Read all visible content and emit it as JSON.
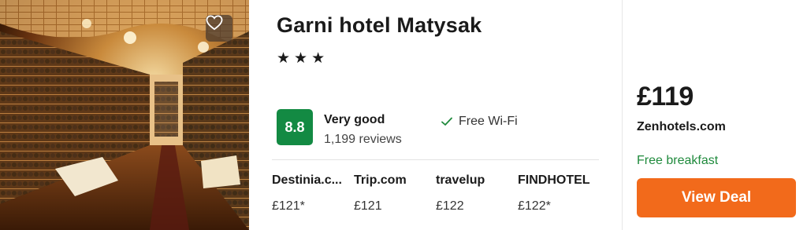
{
  "hotel": {
    "name": "Garni hotel Matysak",
    "stars_display": "★★★",
    "star_count": 3
  },
  "rating": {
    "score": "8.8",
    "label": "Very good",
    "reviews": "1,199 reviews",
    "badge_color": "#138a43"
  },
  "amenities": [
    {
      "icon": "check-icon",
      "label": "Free Wi-Fi"
    }
  ],
  "providers": [
    {
      "name": "Destinia.c...",
      "price": "£121*"
    },
    {
      "name": "Trip.com",
      "price": "£121"
    },
    {
      "name": "travelup",
      "price": "£122"
    },
    {
      "name": "FINDHOTEL",
      "price": "£122*"
    }
  ],
  "deal": {
    "price": "£119",
    "site": "Zenhotels.com",
    "perk": "Free breakfast",
    "button_label": "View Deal",
    "button_color": "#f26a1b",
    "perk_color": "#1f8a3c"
  },
  "photo": {
    "icon": "heart-icon",
    "subject": "wine-cellar-photo"
  }
}
